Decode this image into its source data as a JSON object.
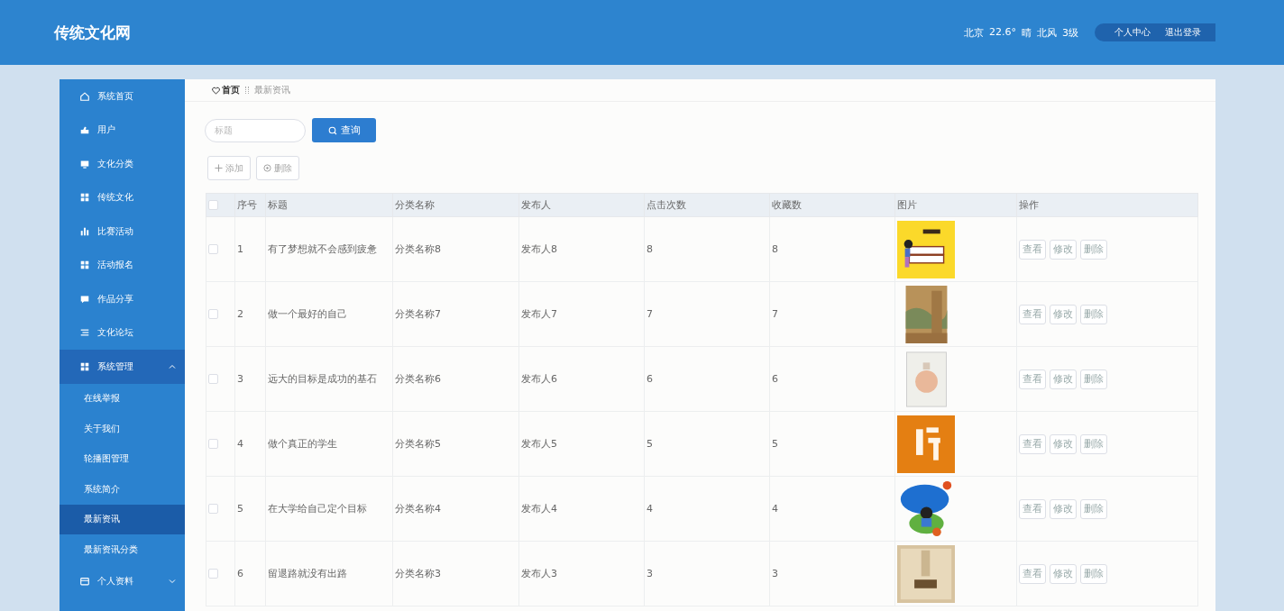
{
  "header": {
    "title": "传统文化网",
    "weather": [
      "北京",
      "22.6°",
      "晴",
      "北风",
      "3级"
    ],
    "buttons": [
      "个人中心",
      "退出登录"
    ]
  },
  "sidebar": {
    "items": [
      {
        "label": "系统首页",
        "selected": false
      },
      {
        "label": "用户",
        "selected": false
      },
      {
        "label": "文化分类",
        "selected": false
      },
      {
        "label": "传统文化",
        "selected": false
      },
      {
        "label": "比赛活动",
        "selected": false
      },
      {
        "label": "活动报名",
        "selected": false
      },
      {
        "label": "作品分享",
        "selected": false
      },
      {
        "label": "文化论坛",
        "selected": false
      },
      {
        "label": "系统管理",
        "selected": false,
        "expanded": true,
        "children": [
          {
            "label": "在线举报",
            "selected": false
          },
          {
            "label": "关于我们",
            "selected": false
          },
          {
            "label": "轮播图管理",
            "selected": false
          },
          {
            "label": "系统简介",
            "selected": false
          },
          {
            "label": "最新资讯",
            "selected": true
          },
          {
            "label": "最新资讯分类",
            "selected": false
          }
        ]
      },
      {
        "label": "个人资料",
        "selected": false,
        "expanded": false
      }
    ]
  },
  "breadcrumb": [
    "首页",
    "最新资讯"
  ],
  "search": {
    "placeholder": "标题",
    "button": "查询"
  },
  "actions": [
    "添加",
    "删除"
  ],
  "table": {
    "all_checked": false,
    "columns": [
      "序号",
      "标题",
      "分类名称",
      "发布人",
      "点击次数",
      "收藏数",
      "图片",
      "操作"
    ],
    "rows": [
      {
        "checked": false,
        "cells": [
          "1",
          "有了梦想就不会感到疲惫",
          "分类名称8",
          "发布人8",
          "8",
          "8"
        ],
        "buttons": [
          "查看",
          "修改",
          "删除"
        ]
      },
      {
        "checked": false,
        "cells": [
          "2",
          "做一个最好的自己",
          "分类名称7",
          "发布人7",
          "7",
          "7"
        ],
        "buttons": [
          "查看",
          "修改",
          "删除"
        ]
      },
      {
        "checked": false,
        "cells": [
          "3",
          "远大的目标是成功的基石",
          "分类名称6",
          "发布人6",
          "6",
          "6"
        ],
        "buttons": [
          "查看",
          "修改",
          "删除"
        ]
      },
      {
        "checked": false,
        "cells": [
          "4",
          "做个真正的学生",
          "分类名称5",
          "发布人5",
          "5",
          "5"
        ],
        "buttons": [
          "查看",
          "修改",
          "删除"
        ]
      },
      {
        "checked": false,
        "cells": [
          "5",
          "在大学给自己定个目标",
          "分类名称4",
          "发布人4",
          "4",
          "4"
        ],
        "buttons": [
          "查看",
          "修改",
          "删除"
        ]
      },
      {
        "checked": false,
        "cells": [
          "6",
          "留退路就没有出路",
          "分类名称3",
          "发布人3",
          "3",
          "3"
        ],
        "buttons": [
          "查看",
          "修改",
          "删除"
        ]
      }
    ]
  }
}
